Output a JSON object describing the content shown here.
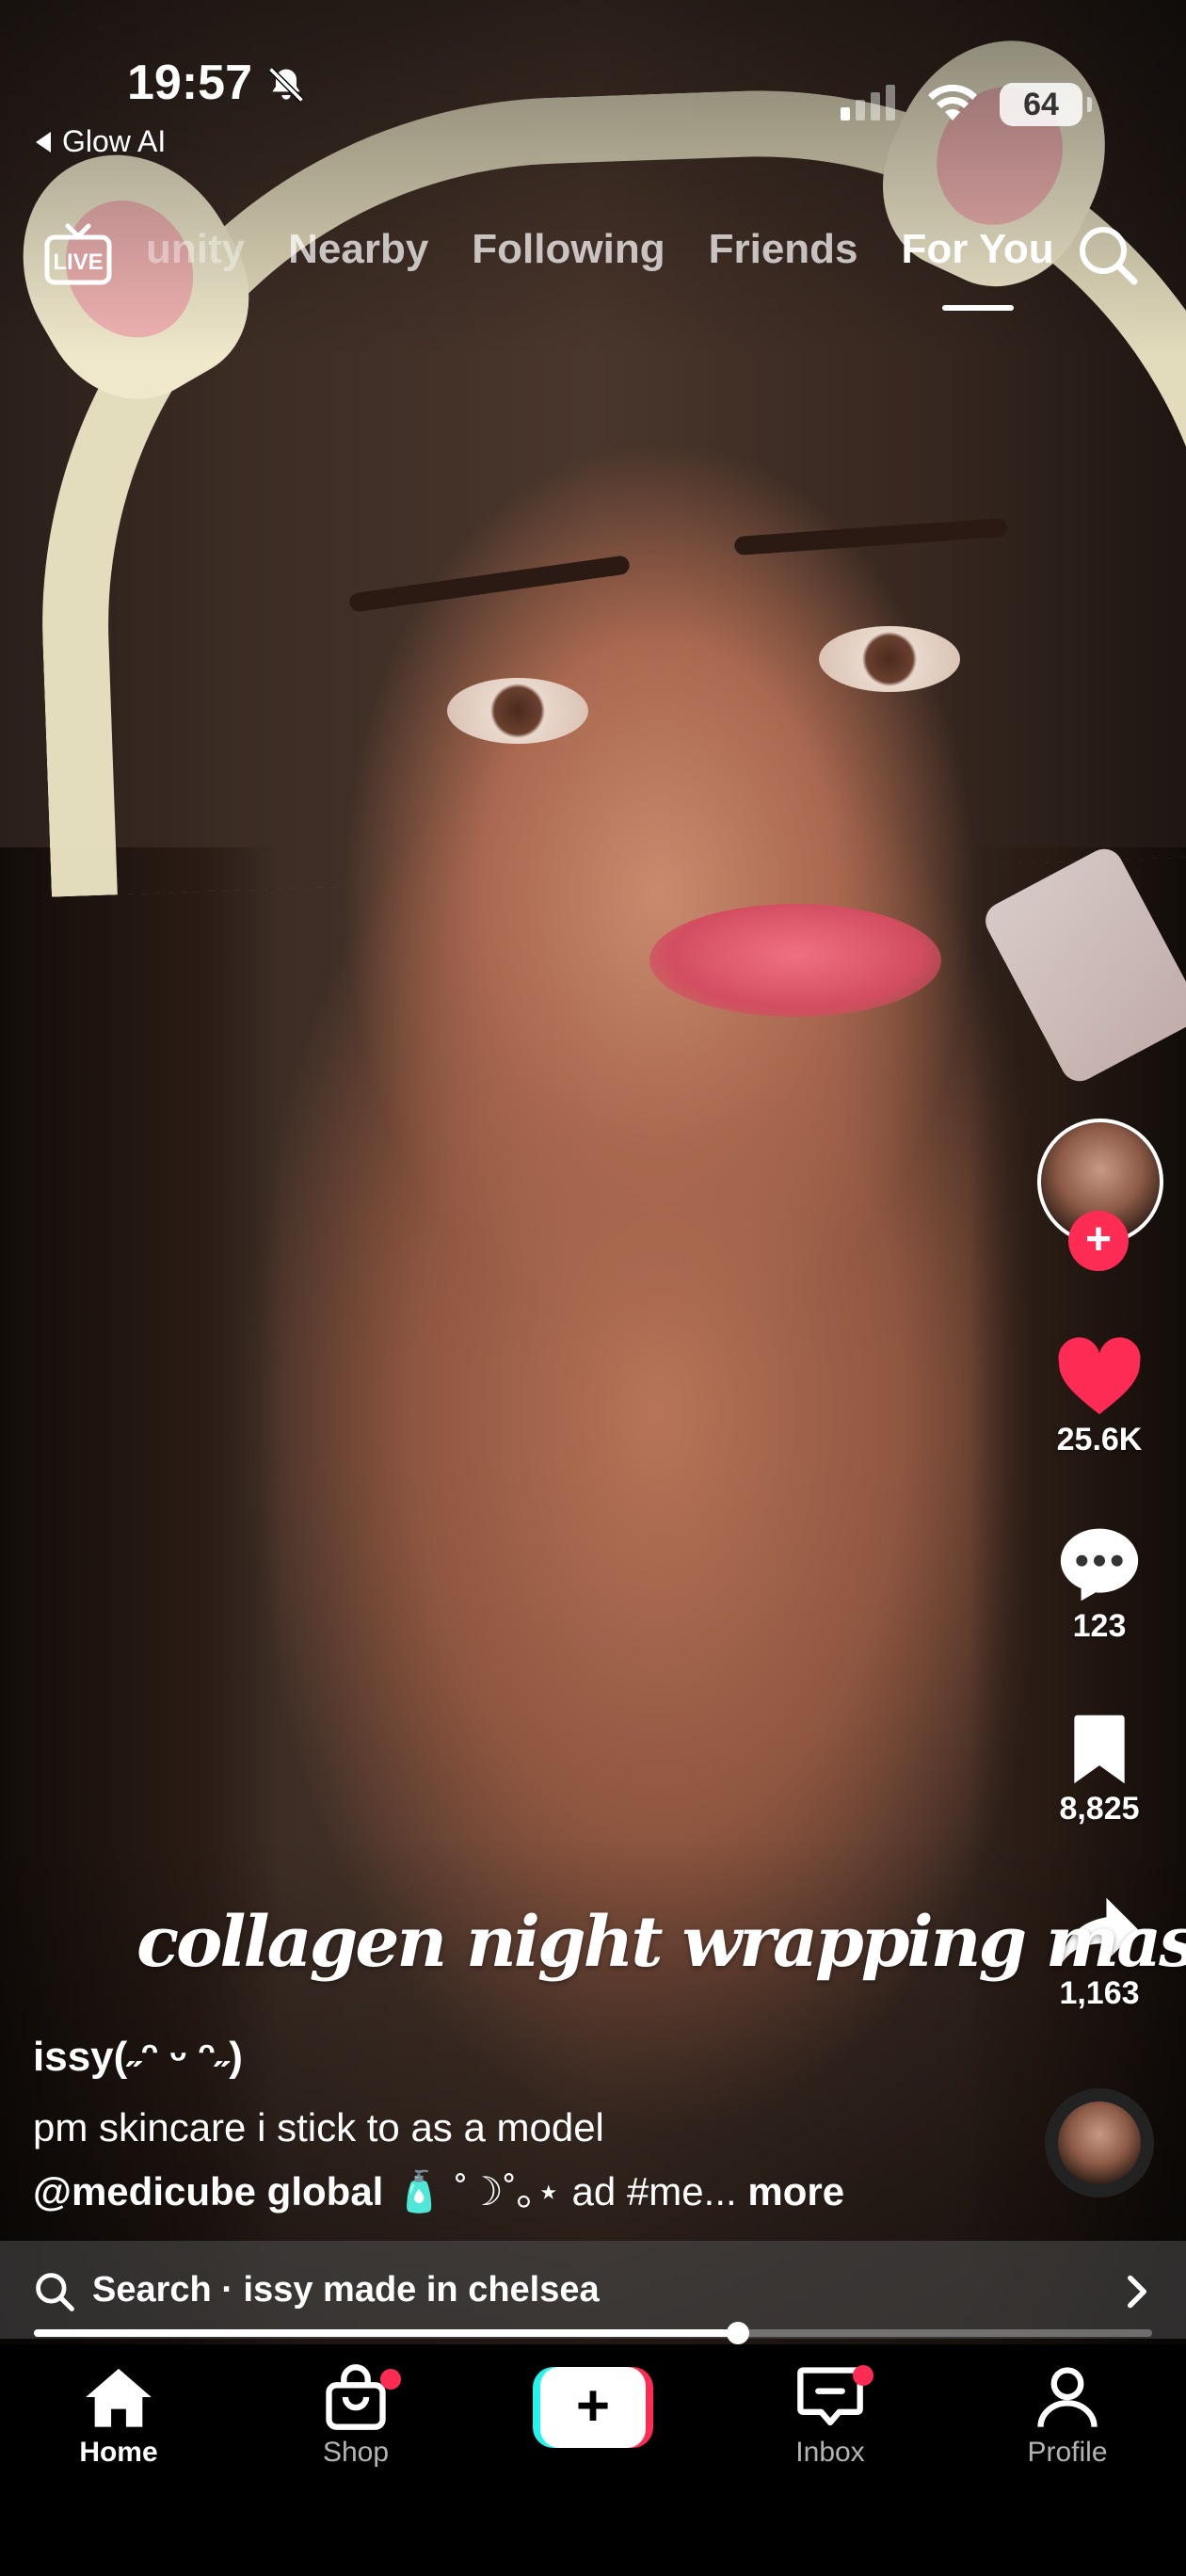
{
  "status_bar": {
    "time": "19:57",
    "back_app": "Glow AI",
    "battery": "64",
    "icons": [
      "bell-muted-icon",
      "signal-icon",
      "wifi-icon",
      "battery-icon"
    ]
  },
  "top_nav": {
    "live_label": "LIVE",
    "tabs": [
      {
        "label": "unity",
        "state": "partial"
      },
      {
        "label": "Nearby",
        "state": "inactive"
      },
      {
        "label": "Following",
        "state": "inactive"
      },
      {
        "label": "Friends",
        "state": "inactive"
      },
      {
        "label": "For You",
        "state": "active"
      }
    ],
    "search_icon": "search-icon"
  },
  "rail": {
    "likes": "25.6K",
    "comments": "123",
    "saves": "8,825",
    "shares": "1,163",
    "follow_plus": "+"
  },
  "video": {
    "overlay_text": "collagen night wrapping mask"
  },
  "caption": {
    "username": "issy(˶ᵔ ᵕ ᵔ˶)",
    "description": "pm skincare i stick to as a model",
    "mention": "@medicube global",
    "tail": " 🧴 ˚☽˚｡⋆ ad #me...",
    "more": "more"
  },
  "search_suggestion": {
    "prefix": "Search",
    "separator": " · ",
    "query": "issy made in chelsea"
  },
  "playback": {
    "progress_fraction": 0.63
  },
  "bottom_nav": {
    "items": [
      {
        "label": "Home",
        "icon": "home-icon",
        "active": true
      },
      {
        "label": "Shop",
        "icon": "shop-icon",
        "active": false,
        "dot": true
      },
      {
        "label": "",
        "icon": "create-plus-icon",
        "active": false
      },
      {
        "label": "Inbox",
        "icon": "inbox-icon",
        "active": false,
        "dot": true
      },
      {
        "label": "Profile",
        "icon": "profile-icon",
        "active": false
      }
    ]
  },
  "colors": {
    "accent": "#fe2c55",
    "cyan": "#25f4ee",
    "like": "#fe2c55"
  }
}
